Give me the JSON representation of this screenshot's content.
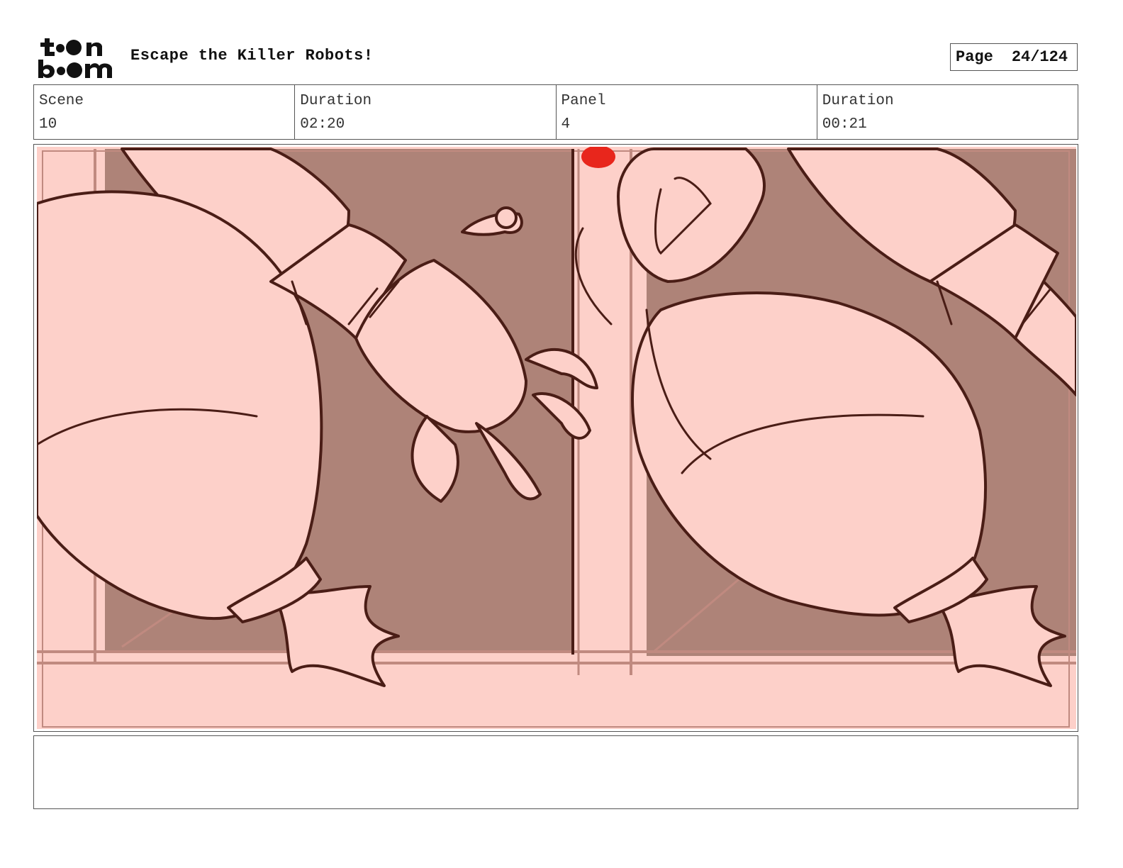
{
  "header": {
    "project_title": "Escape the Killer Robots!",
    "page_label": "Page",
    "page_number": "24/124"
  },
  "logo": {
    "text": "toon boom"
  },
  "info": {
    "scene_label": "Scene",
    "scene_value": "10",
    "scene_duration_label": "Duration",
    "scene_duration_value": "02:20",
    "panel_label": "Panel",
    "panel_value": "4",
    "panel_duration_label": "Duration",
    "panel_duration_value": "00:21"
  },
  "notes": {
    "text": ""
  },
  "colors": {
    "sketch_bg": "#fdd0c9",
    "shadow": "#ae8378",
    "line": "#4a1d16",
    "accent_red": "#e8261c"
  }
}
